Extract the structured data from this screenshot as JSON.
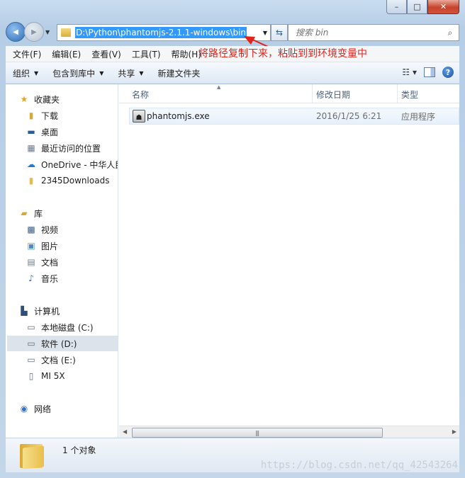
{
  "window": {
    "minimize": "–",
    "maximize": "□",
    "close": "✕"
  },
  "navigation": {
    "back_icon": "◀",
    "forward_icon": "▶",
    "address_path": "D:\\Python\\phantomjs-2.1.1-windows\\bin",
    "refresh_icon": "⇆",
    "search_placeholder": "搜索 bin",
    "search_icon": "⌕"
  },
  "menu": {
    "items": [
      "文件(F)",
      "编辑(E)",
      "查看(V)",
      "工具(T)",
      "帮助(H)"
    ]
  },
  "annotation": {
    "text": "将路径复制下来，粘贴到到环境变量中",
    "color": "#e0231b"
  },
  "toolbar": {
    "organize": "组织",
    "include_in_library": "包含到库中",
    "share": "共享",
    "new_folder": "新建文件夹",
    "help_icon": "?"
  },
  "sidebar": {
    "favorites": "收藏夹",
    "downloads": "下载",
    "desktop": "桌面",
    "recent": "最近访问的位置",
    "onedrive": "OneDrive - 中华人民",
    "downloads2345": "2345Downloads",
    "libraries": "库",
    "videos": "视频",
    "pictures": "图片",
    "documents": "文档",
    "music": "音乐",
    "computer": "计算机",
    "drive_c": "本地磁盘 (C:)",
    "drive_d": "软件 (D:)",
    "drive_e": "文档 (E:)",
    "phone": "MI 5X",
    "network": "网络"
  },
  "columns": {
    "name": "名称",
    "modified": "修改日期",
    "type": "类型"
  },
  "files": [
    {
      "name": "phantomjs.exe",
      "modified": "2016/1/25 6:21",
      "type": "应用程序"
    }
  ],
  "status": {
    "count": "1 个对象"
  },
  "watermark": "https://blog.csdn.net/qq_42543264"
}
